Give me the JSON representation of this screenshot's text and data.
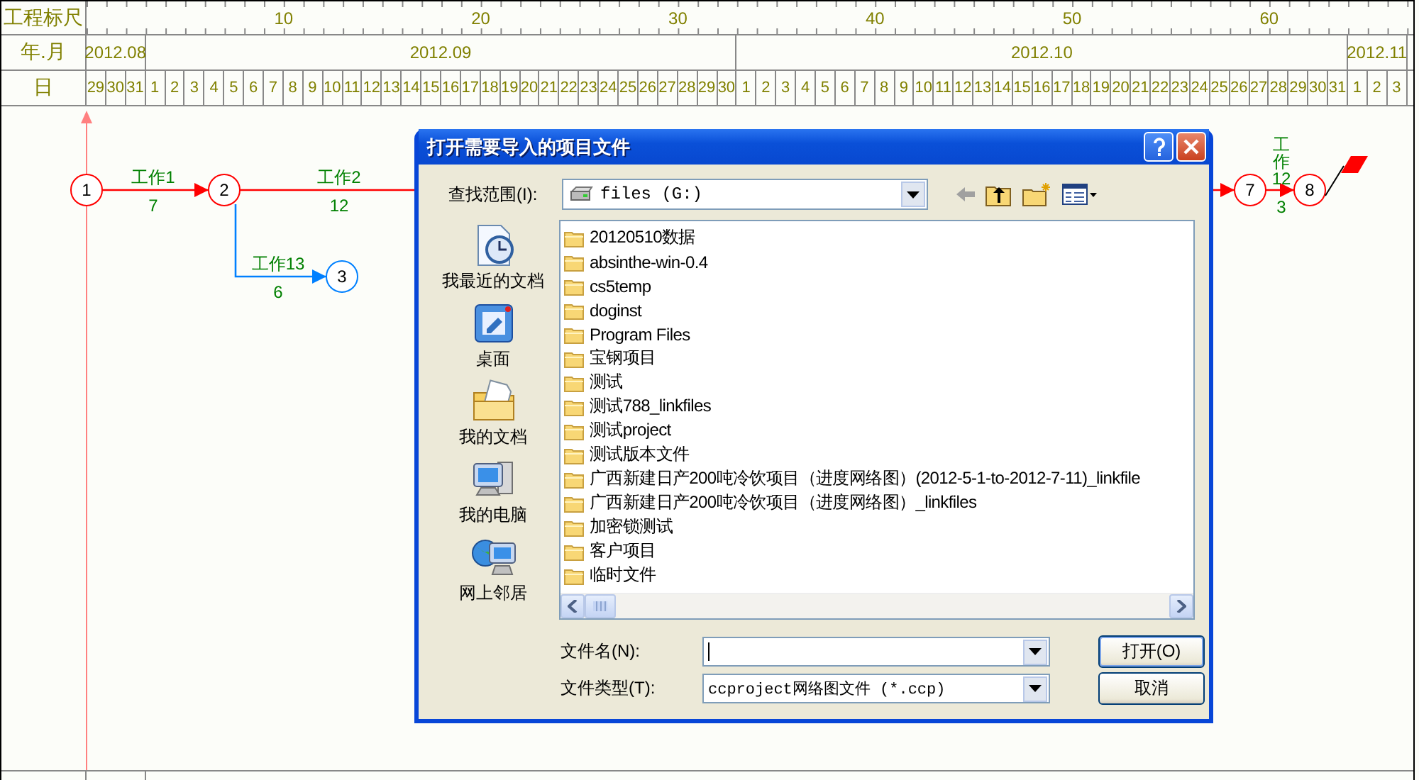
{
  "ruler": {
    "label": "工程标尺",
    "ticks": [
      "10",
      "20",
      "30",
      "40",
      "50",
      "60"
    ]
  },
  "months": {
    "label": "年.月",
    "items": [
      {
        "label": "2012.08",
        "days": [
          "29",
          "30",
          "31"
        ]
      },
      {
        "label": "2012.09",
        "days": [
          "1",
          "2",
          "3",
          "4",
          "5",
          "6",
          "7",
          "8",
          "9",
          "10",
          "11",
          "12",
          "13",
          "14",
          "15",
          "16",
          "17",
          "18",
          "19",
          "20",
          "21",
          "22",
          "23",
          "24",
          "25",
          "26",
          "27",
          "28",
          "29",
          "30"
        ]
      },
      {
        "label": "2012.10",
        "days": [
          "1",
          "2",
          "3",
          "4",
          "5",
          "6",
          "7",
          "8",
          "9",
          "10",
          "11",
          "12",
          "13",
          "14",
          "15",
          "16",
          "17",
          "18",
          "19",
          "20",
          "21",
          "22",
          "23",
          "24",
          "25",
          "26",
          "27",
          "28",
          "29",
          "30",
          "31"
        ]
      },
      {
        "label": "2012.11",
        "days": [
          "1",
          "2",
          "3"
        ]
      }
    ]
  },
  "days_label": "日",
  "diagram": {
    "nodes": [
      {
        "label": "1",
        "color": "#ff0000"
      },
      {
        "label": "2",
        "color": "#ff0000"
      },
      {
        "label": "3",
        "color": "#0080ff"
      },
      {
        "label": "7",
        "color": "#ff0000"
      },
      {
        "label": "8",
        "color": "#ff0000"
      }
    ],
    "activities": [
      {
        "name": "工作1",
        "duration": "7",
        "color": "#ff0000"
      },
      {
        "name": "工作2",
        "duration": "12",
        "color": "#ff0000"
      },
      {
        "name": "工作13",
        "duration": "6",
        "color": "#0080ff"
      },
      {
        "name": "工作12",
        "duration": "3",
        "color": "#ff0000"
      }
    ]
  },
  "dialog": {
    "title": "打开需要导入的项目文件",
    "look_in": {
      "label": "查找范围(I):",
      "value": "files (G:)"
    },
    "places": [
      "我最近的文档",
      "桌面",
      "我的文档",
      "我的电脑",
      "网上邻居"
    ],
    "files": [
      "20120510数据",
      "absinthe-win-0.4",
      "cs5temp",
      "doginst",
      "Program Files",
      "宝钢项目",
      "测试",
      "测试788_linkfiles",
      "测试project",
      "测试版本文件",
      "广西新建日产200吨冷饮项目（进度网络图）(2012-5-1-to-2012-7-11)_linkfile",
      "广西新建日产200吨冷饮项目（进度网络图）_linkfiles",
      "加密锁测试",
      "客户项目",
      "临时文件"
    ],
    "file_name": {
      "label": "文件名(N):"
    },
    "file_type": {
      "label": "文件类型(T):",
      "value": "ccproject网络图文件 (*.ccp)"
    },
    "buttons": [
      "打开(O)",
      "取消"
    ]
  }
}
